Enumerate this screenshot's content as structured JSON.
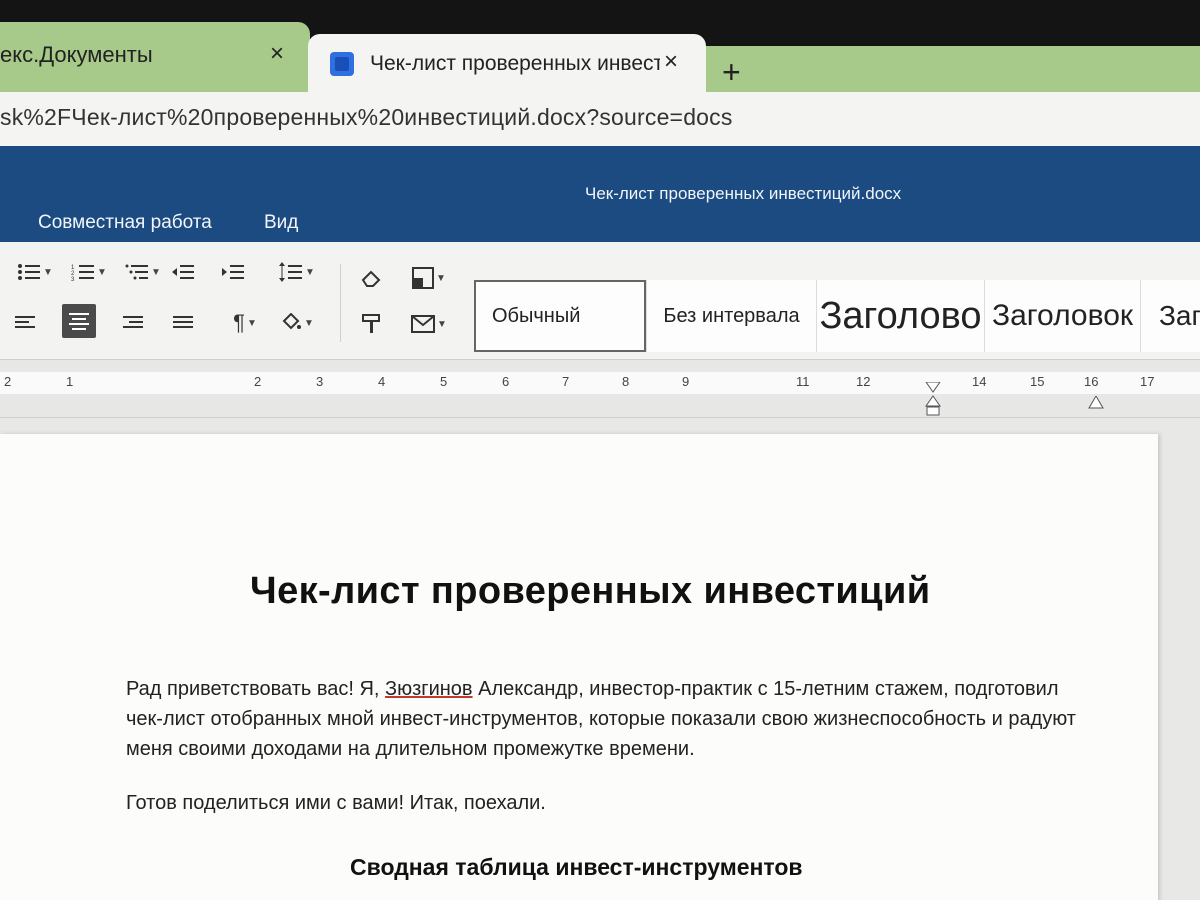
{
  "tabs": [
    {
      "title": "екс.Документы",
      "close": "×",
      "active": false
    },
    {
      "title": "Чек-лист проверенных инвест",
      "close": "×",
      "active": true
    }
  ],
  "new_tab": "+",
  "address": {
    "url": "sk%2FЧек-лист%20проверенных%20инвестиций.docx?source=docs"
  },
  "app": {
    "document_title": "Чек-лист проверенных инвестиций.docx",
    "menu": [
      "Совместная работа",
      "Вид"
    ],
    "accent": "#1c4b82"
  },
  "toolbar": {
    "paragraph_mark": "¶",
    "styles": [
      "Обычный",
      "Без интервала",
      "Заголово",
      "Заголовок",
      "Заг"
    ]
  },
  "ruler": {
    "numbers": [
      "2",
      "1",
      "2",
      "3",
      "4",
      "5",
      "6",
      "7",
      "8",
      "9",
      "11",
      "12",
      "14",
      "15",
      "16",
      "17"
    ]
  },
  "document": {
    "heading": "Чек-лист проверенных инвестиций",
    "paragraph1_before": "Рад приветствовать вас! Я, ",
    "paragraph1_name": "Зюзгинов",
    "paragraph1_after": " Александр, инвестор-практик с 15-летним стажем, подготовил чек-лист отобранных мной инвест-инструментов, которые показали свою жизнеспособность и радуют меня своими доходами на длительном промежутке времени.",
    "paragraph2": "Готов поделиться ими с вами! Итак, поехали.",
    "subheading": "Сводная таблица инвест-инструментов"
  }
}
